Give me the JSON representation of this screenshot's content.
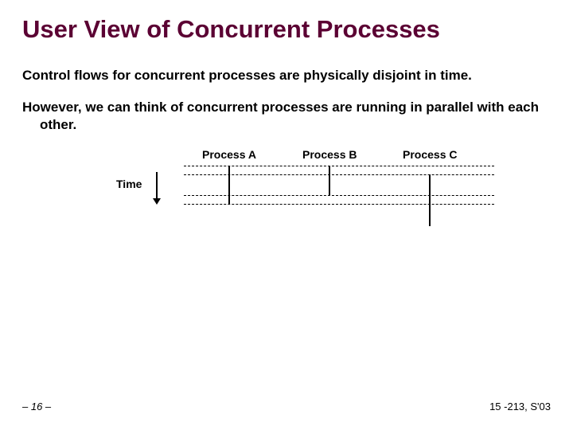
{
  "title": "User View of Concurrent Processes",
  "bullets": [
    "Control flows for concurrent processes are physically disjoint in time.",
    "However, we can think of concurrent processes are running in parallel with each other."
  ],
  "diagram": {
    "time_label": "Time",
    "processes": [
      "Process A",
      "Process B",
      "Process C"
    ]
  },
  "footer": {
    "left": "– 16 –",
    "right": "15 -213, S'03"
  }
}
